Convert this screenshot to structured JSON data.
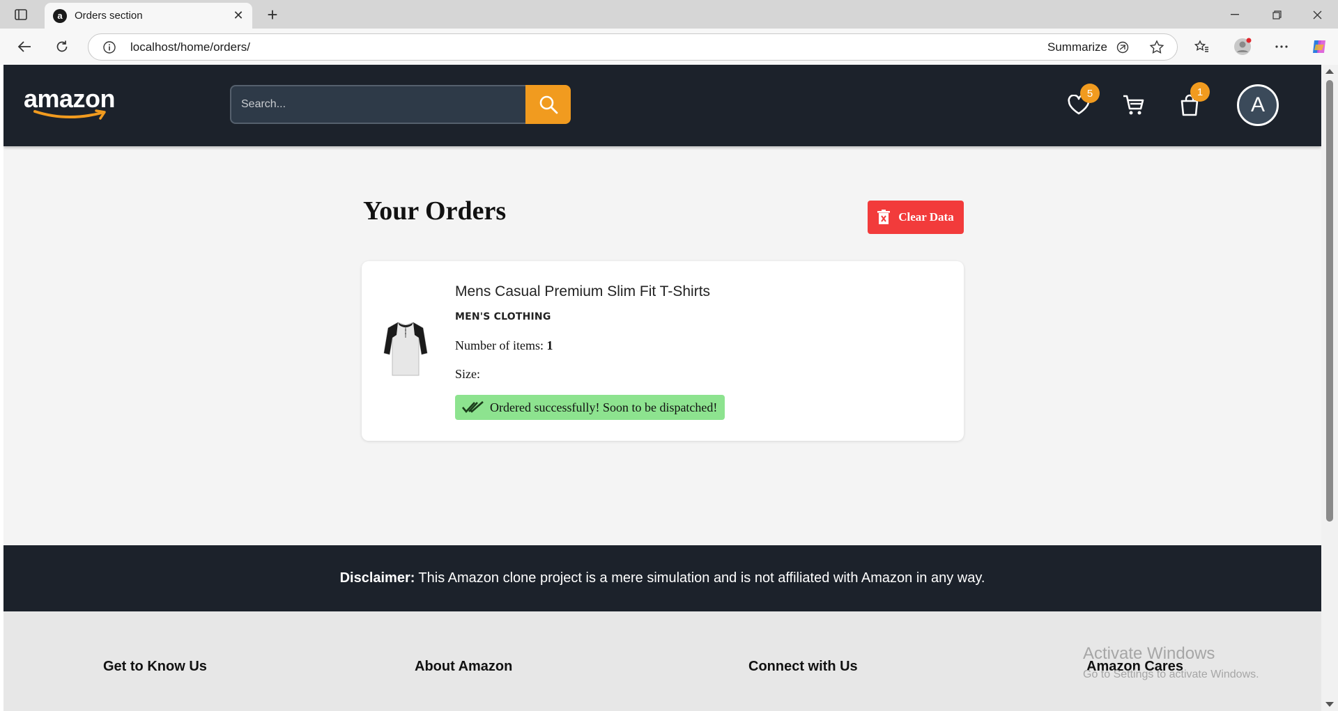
{
  "browser": {
    "tab_title": "Orders section",
    "tab_favicon": "a",
    "url": "localhost/home/orders/",
    "summarize_label": "Summarize"
  },
  "header": {
    "logo_text": "amazon",
    "search_placeholder": "Search...",
    "wishlist_count": "5",
    "orders_count": "1",
    "avatar_letter": "A",
    "accent_color": "#f19b1f",
    "background_color": "#1c222b"
  },
  "orders": {
    "title": "Your Orders",
    "clear_label": "Clear Data",
    "items": [
      {
        "name": "Mens Casual Premium Slim Fit T-Shirts",
        "category": "MEN'S CLOTHING",
        "quantity_label": "Number of items:",
        "quantity": "1",
        "size_label": "Size:",
        "status": "Ordered successfully! Soon to be dispatched!"
      }
    ]
  },
  "disclaimer": {
    "label": "Disclaimer:",
    "text": "This Amazon clone project is a mere simulation and is not affiliated with Amazon in any way."
  },
  "footer": {
    "columns": [
      "Get to Know Us",
      "About Amazon",
      "Connect with Us",
      "Amazon Cares"
    ]
  },
  "watermark": {
    "title": "Activate Windows",
    "subtitle": "Go to Settings to activate Windows."
  }
}
